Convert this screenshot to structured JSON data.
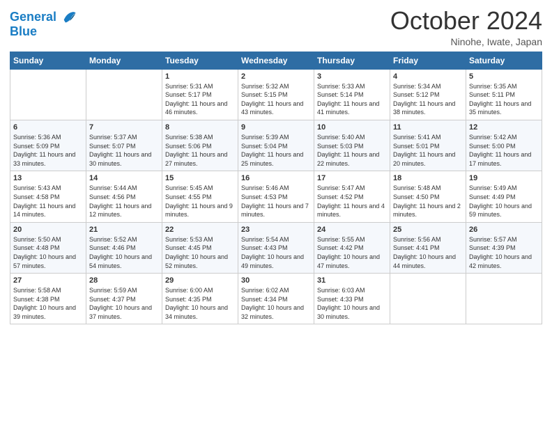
{
  "header": {
    "logo_line1": "General",
    "logo_line2": "Blue",
    "month": "October 2024",
    "location": "Ninohe, Iwate, Japan"
  },
  "weekdays": [
    "Sunday",
    "Monday",
    "Tuesday",
    "Wednesday",
    "Thursday",
    "Friday",
    "Saturday"
  ],
  "weeks": [
    [
      {
        "day": "",
        "sunrise": "",
        "sunset": "",
        "daylight": ""
      },
      {
        "day": "",
        "sunrise": "",
        "sunset": "",
        "daylight": ""
      },
      {
        "day": "1",
        "sunrise": "Sunrise: 5:31 AM",
        "sunset": "Sunset: 5:17 PM",
        "daylight": "Daylight: 11 hours and 46 minutes."
      },
      {
        "day": "2",
        "sunrise": "Sunrise: 5:32 AM",
        "sunset": "Sunset: 5:15 PM",
        "daylight": "Daylight: 11 hours and 43 minutes."
      },
      {
        "day": "3",
        "sunrise": "Sunrise: 5:33 AM",
        "sunset": "Sunset: 5:14 PM",
        "daylight": "Daylight: 11 hours and 41 minutes."
      },
      {
        "day": "4",
        "sunrise": "Sunrise: 5:34 AM",
        "sunset": "Sunset: 5:12 PM",
        "daylight": "Daylight: 11 hours and 38 minutes."
      },
      {
        "day": "5",
        "sunrise": "Sunrise: 5:35 AM",
        "sunset": "Sunset: 5:11 PM",
        "daylight": "Daylight: 11 hours and 35 minutes."
      }
    ],
    [
      {
        "day": "6",
        "sunrise": "Sunrise: 5:36 AM",
        "sunset": "Sunset: 5:09 PM",
        "daylight": "Daylight: 11 hours and 33 minutes."
      },
      {
        "day": "7",
        "sunrise": "Sunrise: 5:37 AM",
        "sunset": "Sunset: 5:07 PM",
        "daylight": "Daylight: 11 hours and 30 minutes."
      },
      {
        "day": "8",
        "sunrise": "Sunrise: 5:38 AM",
        "sunset": "Sunset: 5:06 PM",
        "daylight": "Daylight: 11 hours and 27 minutes."
      },
      {
        "day": "9",
        "sunrise": "Sunrise: 5:39 AM",
        "sunset": "Sunset: 5:04 PM",
        "daylight": "Daylight: 11 hours and 25 minutes."
      },
      {
        "day": "10",
        "sunrise": "Sunrise: 5:40 AM",
        "sunset": "Sunset: 5:03 PM",
        "daylight": "Daylight: 11 hours and 22 minutes."
      },
      {
        "day": "11",
        "sunrise": "Sunrise: 5:41 AM",
        "sunset": "Sunset: 5:01 PM",
        "daylight": "Daylight: 11 hours and 20 minutes."
      },
      {
        "day": "12",
        "sunrise": "Sunrise: 5:42 AM",
        "sunset": "Sunset: 5:00 PM",
        "daylight": "Daylight: 11 hours and 17 minutes."
      }
    ],
    [
      {
        "day": "13",
        "sunrise": "Sunrise: 5:43 AM",
        "sunset": "Sunset: 4:58 PM",
        "daylight": "Daylight: 11 hours and 14 minutes."
      },
      {
        "day": "14",
        "sunrise": "Sunrise: 5:44 AM",
        "sunset": "Sunset: 4:56 PM",
        "daylight": "Daylight: 11 hours and 12 minutes."
      },
      {
        "day": "15",
        "sunrise": "Sunrise: 5:45 AM",
        "sunset": "Sunset: 4:55 PM",
        "daylight": "Daylight: 11 hours and 9 minutes."
      },
      {
        "day": "16",
        "sunrise": "Sunrise: 5:46 AM",
        "sunset": "Sunset: 4:53 PM",
        "daylight": "Daylight: 11 hours and 7 minutes."
      },
      {
        "day": "17",
        "sunrise": "Sunrise: 5:47 AM",
        "sunset": "Sunset: 4:52 PM",
        "daylight": "Daylight: 11 hours and 4 minutes."
      },
      {
        "day": "18",
        "sunrise": "Sunrise: 5:48 AM",
        "sunset": "Sunset: 4:50 PM",
        "daylight": "Daylight: 11 hours and 2 minutes."
      },
      {
        "day": "19",
        "sunrise": "Sunrise: 5:49 AM",
        "sunset": "Sunset: 4:49 PM",
        "daylight": "Daylight: 10 hours and 59 minutes."
      }
    ],
    [
      {
        "day": "20",
        "sunrise": "Sunrise: 5:50 AM",
        "sunset": "Sunset: 4:48 PM",
        "daylight": "Daylight: 10 hours and 57 minutes."
      },
      {
        "day": "21",
        "sunrise": "Sunrise: 5:52 AM",
        "sunset": "Sunset: 4:46 PM",
        "daylight": "Daylight: 10 hours and 54 minutes."
      },
      {
        "day": "22",
        "sunrise": "Sunrise: 5:53 AM",
        "sunset": "Sunset: 4:45 PM",
        "daylight": "Daylight: 10 hours and 52 minutes."
      },
      {
        "day": "23",
        "sunrise": "Sunrise: 5:54 AM",
        "sunset": "Sunset: 4:43 PM",
        "daylight": "Daylight: 10 hours and 49 minutes."
      },
      {
        "day": "24",
        "sunrise": "Sunrise: 5:55 AM",
        "sunset": "Sunset: 4:42 PM",
        "daylight": "Daylight: 10 hours and 47 minutes."
      },
      {
        "day": "25",
        "sunrise": "Sunrise: 5:56 AM",
        "sunset": "Sunset: 4:41 PM",
        "daylight": "Daylight: 10 hours and 44 minutes."
      },
      {
        "day": "26",
        "sunrise": "Sunrise: 5:57 AM",
        "sunset": "Sunset: 4:39 PM",
        "daylight": "Daylight: 10 hours and 42 minutes."
      }
    ],
    [
      {
        "day": "27",
        "sunrise": "Sunrise: 5:58 AM",
        "sunset": "Sunset: 4:38 PM",
        "daylight": "Daylight: 10 hours and 39 minutes."
      },
      {
        "day": "28",
        "sunrise": "Sunrise: 5:59 AM",
        "sunset": "Sunset: 4:37 PM",
        "daylight": "Daylight: 10 hours and 37 minutes."
      },
      {
        "day": "29",
        "sunrise": "Sunrise: 6:00 AM",
        "sunset": "Sunset: 4:35 PM",
        "daylight": "Daylight: 10 hours and 34 minutes."
      },
      {
        "day": "30",
        "sunrise": "Sunrise: 6:02 AM",
        "sunset": "Sunset: 4:34 PM",
        "daylight": "Daylight: 10 hours and 32 minutes."
      },
      {
        "day": "31",
        "sunrise": "Sunrise: 6:03 AM",
        "sunset": "Sunset: 4:33 PM",
        "daylight": "Daylight: 10 hours and 30 minutes."
      },
      {
        "day": "",
        "sunrise": "",
        "sunset": "",
        "daylight": ""
      },
      {
        "day": "",
        "sunrise": "",
        "sunset": "",
        "daylight": ""
      }
    ]
  ]
}
